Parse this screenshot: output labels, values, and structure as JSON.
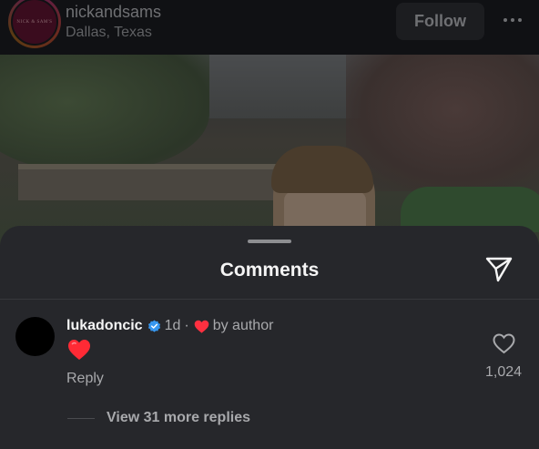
{
  "post": {
    "username": "nickandsams",
    "location": "Dallas, Texas",
    "follow_label": "Follow",
    "avatar_mark": "NICK & SAM'S"
  },
  "comments_sheet": {
    "title": "Comments",
    "comment": {
      "username": "lukadoncic",
      "time": "1d",
      "separator": "·",
      "liked_by_label": "by author",
      "text": "❤️",
      "reply_label": "Reply",
      "like_count": "1,024",
      "view_replies_label": "View 31 more replies"
    }
  },
  "colors": {
    "sheet_background": "#26272b",
    "verified_blue": "#3797f0",
    "heart_red": "#ff3040",
    "text_primary": "#f5f5f5",
    "text_secondary": "#a8a9ac"
  },
  "icons": {
    "share": "paper-plane-icon",
    "like": "heart-outline-icon",
    "verified": "verified-badge-icon",
    "more": "more-horizontal-icon"
  }
}
